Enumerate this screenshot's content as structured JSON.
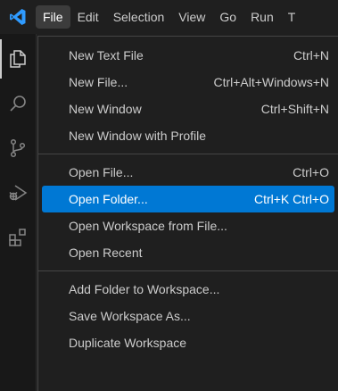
{
  "menubar": {
    "items": [
      "File",
      "Edit",
      "Selection",
      "View",
      "Go",
      "Run",
      "T"
    ]
  },
  "activity_bar": {
    "icons": [
      "explorer-icon",
      "search-icon",
      "source-control-icon",
      "run-debug-icon",
      "extensions-icon"
    ]
  },
  "file_menu": {
    "groups": [
      [
        {
          "label": "New Text File",
          "shortcut": "Ctrl+N"
        },
        {
          "label": "New File...",
          "shortcut": "Ctrl+Alt+Windows+N"
        },
        {
          "label": "New Window",
          "shortcut": "Ctrl+Shift+N"
        },
        {
          "label": "New Window with Profile",
          "shortcut": ""
        }
      ],
      [
        {
          "label": "Open File...",
          "shortcut": "Ctrl+O"
        },
        {
          "label": "Open Folder...",
          "shortcut": "Ctrl+K Ctrl+O",
          "highlighted": true
        },
        {
          "label": "Open Workspace from File...",
          "shortcut": ""
        },
        {
          "label": "Open Recent",
          "shortcut": ""
        }
      ],
      [
        {
          "label": "Add Folder to Workspace...",
          "shortcut": ""
        },
        {
          "label": "Save Workspace As...",
          "shortcut": ""
        },
        {
          "label": "Duplicate Workspace",
          "shortcut": ""
        }
      ]
    ]
  },
  "colors": {
    "highlight": "#0078d4",
    "logo": "#2f9bff",
    "background": "#1f1f1f"
  }
}
